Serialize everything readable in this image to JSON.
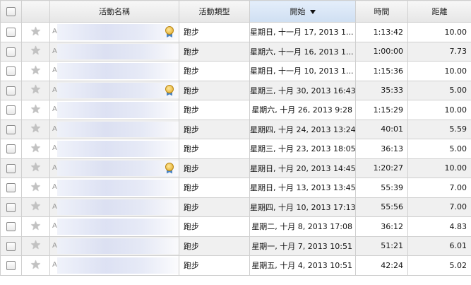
{
  "header": {
    "name": "活動名稱",
    "type": "活動類型",
    "start": "開始",
    "time": "時間",
    "distance": "距離"
  },
  "rows": [
    {
      "name": "A",
      "type": "跑步",
      "start": "星期日, 十一月 17, 2013 1...",
      "time": "1:13:42",
      "distance": "10.00",
      "medal": true
    },
    {
      "name": "A",
      "type": "跑步",
      "start": "星期六, 十一月 16, 2013 1...",
      "time": "1:00:00",
      "distance": "7.73",
      "medal": false
    },
    {
      "name": "A",
      "type": "跑步",
      "start": "星期日, 十一月 10, 2013 1...",
      "time": "1:15:36",
      "distance": "10.00",
      "medal": false
    },
    {
      "name": "A",
      "type": "跑步",
      "start": "星期三, 十月 30, 2013 16:43",
      "time": "35:33",
      "distance": "5.00",
      "medal": true
    },
    {
      "name": "A",
      "type": "跑步",
      "start": "星期六, 十月 26, 2013 9:28",
      "time": "1:15:29",
      "distance": "10.00",
      "medal": false
    },
    {
      "name": "A",
      "type": "跑步",
      "start": "星期四, 十月 24, 2013 13:24",
      "time": "40:01",
      "distance": "5.59",
      "medal": false
    },
    {
      "name": "A",
      "type": "跑步",
      "start": "星期三, 十月 23, 2013 18:05",
      "time": "36:13",
      "distance": "5.00",
      "medal": false
    },
    {
      "name": "A",
      "type": "跑步",
      "start": "星期日, 十月 20, 2013 14:45",
      "time": "1:20:27",
      "distance": "10.00",
      "medal": true
    },
    {
      "name": "A",
      "type": "跑步",
      "start": "星期日, 十月 13, 2013 13:45",
      "time": "55:39",
      "distance": "7.00",
      "medal": false
    },
    {
      "name": "A",
      "type": "跑步",
      "start": "星期四, 十月 10, 2013 17:13",
      "time": "55:56",
      "distance": "7.00",
      "medal": false
    },
    {
      "name": "A",
      "type": "跑步",
      "start": "星期二, 十月 8, 2013 17:08",
      "time": "36:12",
      "distance": "4.83",
      "medal": false
    },
    {
      "name": "A",
      "type": "跑步",
      "start": "星期一, 十月 7, 2013 10:51",
      "time": "51:21",
      "distance": "6.01",
      "medal": false
    },
    {
      "name": "A",
      "type": "跑步",
      "start": "星期五, 十月 4, 2013 10:51",
      "time": "42:24",
      "distance": "5.02",
      "medal": false
    }
  ]
}
